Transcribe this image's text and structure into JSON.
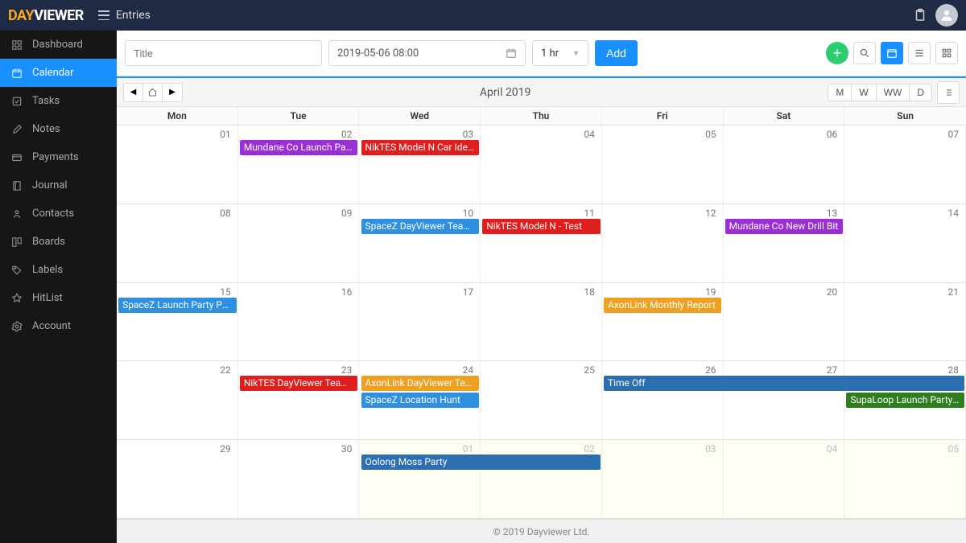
{
  "topbar": {
    "nav_label": "Entries"
  },
  "sidebar": {
    "items": [
      {
        "label": "Dashboard",
        "icon": "dashboard"
      },
      {
        "label": "Calendar",
        "icon": "calendar",
        "active": true
      },
      {
        "label": "Tasks",
        "icon": "tasks"
      },
      {
        "label": "Notes",
        "icon": "notes"
      },
      {
        "label": "Payments",
        "icon": "payments"
      },
      {
        "label": "Journal",
        "icon": "journal"
      },
      {
        "label": "Contacts",
        "icon": "contacts"
      },
      {
        "label": "Boards",
        "icon": "boards"
      },
      {
        "label": "Labels",
        "icon": "labels"
      },
      {
        "label": "HitList",
        "icon": "hitlist"
      },
      {
        "label": "Account",
        "icon": "account"
      }
    ]
  },
  "toolbar": {
    "title_placeholder": "Title",
    "date_value": "2019-05-06 08:00",
    "duration_value": "1 hr",
    "add_label": "Add"
  },
  "calendar": {
    "title": "April 2019",
    "view_buttons": [
      "M",
      "W",
      "WW",
      "D"
    ],
    "day_headers": [
      "Mon",
      "Tue",
      "Wed",
      "Thu",
      "Fri",
      "Sat",
      "Sun"
    ],
    "weeks": [
      {
        "dates": [
          "01",
          "02",
          "03",
          "04",
          "05",
          "06",
          "07"
        ],
        "out": [
          false,
          false,
          false,
          false,
          false,
          false,
          false
        ]
      },
      {
        "dates": [
          "08",
          "09",
          "10",
          "11",
          "12",
          "13",
          "14"
        ],
        "out": [
          false,
          false,
          false,
          false,
          false,
          false,
          false
        ]
      },
      {
        "dates": [
          "15",
          "16",
          "17",
          "18",
          "19",
          "20",
          "21"
        ],
        "out": [
          false,
          false,
          false,
          false,
          false,
          false,
          false
        ]
      },
      {
        "dates": [
          "22",
          "23",
          "24",
          "25",
          "26",
          "27",
          "28"
        ],
        "out": [
          false,
          false,
          false,
          false,
          false,
          false,
          false
        ]
      },
      {
        "dates": [
          "29",
          "30",
          "01",
          "02",
          "03",
          "04",
          "05"
        ],
        "out": [
          false,
          false,
          true,
          true,
          true,
          true,
          true
        ]
      }
    ],
    "events": [
      {
        "week": 0,
        "start": 1,
        "span": 1,
        "row": 0,
        "label": "Mundane Co Launch Party …",
        "color": "#9b2fd6"
      },
      {
        "week": 0,
        "start": 2,
        "span": 1,
        "row": 0,
        "label": "NikTES Model N Car Ideas",
        "color": "#e01e1e"
      },
      {
        "week": 1,
        "start": 2,
        "span": 1,
        "row": 0,
        "label": "SpaceZ DayViewer Team Ro…",
        "color": "#2f8fe0"
      },
      {
        "week": 1,
        "start": 3,
        "span": 1,
        "row": 0,
        "label": "NikTES Model N - Test",
        "color": "#e01e1e"
      },
      {
        "week": 1,
        "start": 5,
        "span": 1,
        "row": 0,
        "label": "Mundane Co New Drill Bit",
        "color": "#9b2fd6"
      },
      {
        "week": 2,
        "start": 0,
        "span": 1,
        "row": 0,
        "label": "SpaceZ Launch Party Paym…",
        "color": "#2f8fe0"
      },
      {
        "week": 2,
        "start": 4,
        "span": 1,
        "row": 0,
        "label": "AxonLink Monthly Report",
        "color": "#f0a020"
      },
      {
        "week": 3,
        "start": 1,
        "span": 1,
        "row": 0,
        "label": "NikTES DayViewer Team Room",
        "color": "#e01e1e"
      },
      {
        "week": 3,
        "start": 2,
        "span": 1,
        "row": 0,
        "label": "AxonLink DayViewer Team …",
        "color": "#f0a020"
      },
      {
        "week": 3,
        "start": 2,
        "span": 1,
        "row": 1,
        "label": "SpaceZ Location Hunt",
        "color": "#2f8fe0"
      },
      {
        "week": 3,
        "start": 4,
        "span": 3,
        "row": 0,
        "label": "Time Off",
        "color": "#2c6fb0"
      },
      {
        "week": 3,
        "start": 6,
        "span": 1,
        "row": 1,
        "label": "SupaLoop Launch Party Pa…",
        "color": "#2e7d1f"
      },
      {
        "week": 4,
        "start": 2,
        "span": 2,
        "row": 0,
        "label": "Oolong Moss Party",
        "color": "#2c6fb0"
      }
    ]
  },
  "footer": {
    "text": "© 2019 Dayviewer Ltd."
  }
}
